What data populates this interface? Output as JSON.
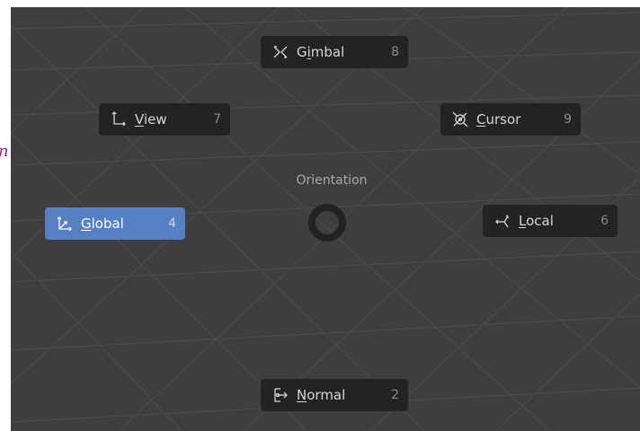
{
  "partial_text": "n",
  "pie_menu": {
    "title": "Orientation",
    "items": [
      {
        "id": "gimbal",
        "pre": "",
        "ul": "G",
        "rest": "imbal",
        "hk": "8",
        "ul_index": 1
      },
      {
        "id": "view",
        "pre": "",
        "ul": "V",
        "rest": "iew",
        "hk": "7"
      },
      {
        "id": "cursor",
        "pre": "",
        "ul": "C",
        "rest": "ursor",
        "hk": "9"
      },
      {
        "id": "global",
        "pre": "",
        "ul": "G",
        "rest": "lobal",
        "hk": "4",
        "active": true
      },
      {
        "id": "local",
        "pre": "",
        "ul": "L",
        "rest": "ocal",
        "hk": "6"
      },
      {
        "id": "normal",
        "pre": "",
        "ul": "N",
        "rest": "ormal",
        "hk": "2"
      }
    ],
    "gimbal": {
      "a": "G",
      "b": "i",
      "c": "mbal",
      "key": "8"
    },
    "view": {
      "a": "V",
      "b": "iew",
      "key": "7"
    },
    "cursor": {
      "a": "C",
      "b": "ursor",
      "key": "9"
    },
    "global": {
      "a": "G",
      "b": "lobal",
      "key": "4"
    },
    "local": {
      "a": "L",
      "b": "ocal",
      "key": "6"
    },
    "normal": {
      "a": "N",
      "b": "ormal",
      "key": "2"
    }
  },
  "colors": {
    "viewport_bg": "#3e3e3e",
    "button_bg": "#232323",
    "active_bg": "#5680c2",
    "text": "#d6d6d6",
    "hotkey": "#8a8a8a"
  },
  "icons": {
    "gimbal": "gimbal-orientation-icon",
    "view": "view-orientation-icon",
    "cursor": "cursor-orientation-icon",
    "global": "global-orientation-icon",
    "local": "local-orientation-icon",
    "normal": "normal-orientation-icon"
  }
}
